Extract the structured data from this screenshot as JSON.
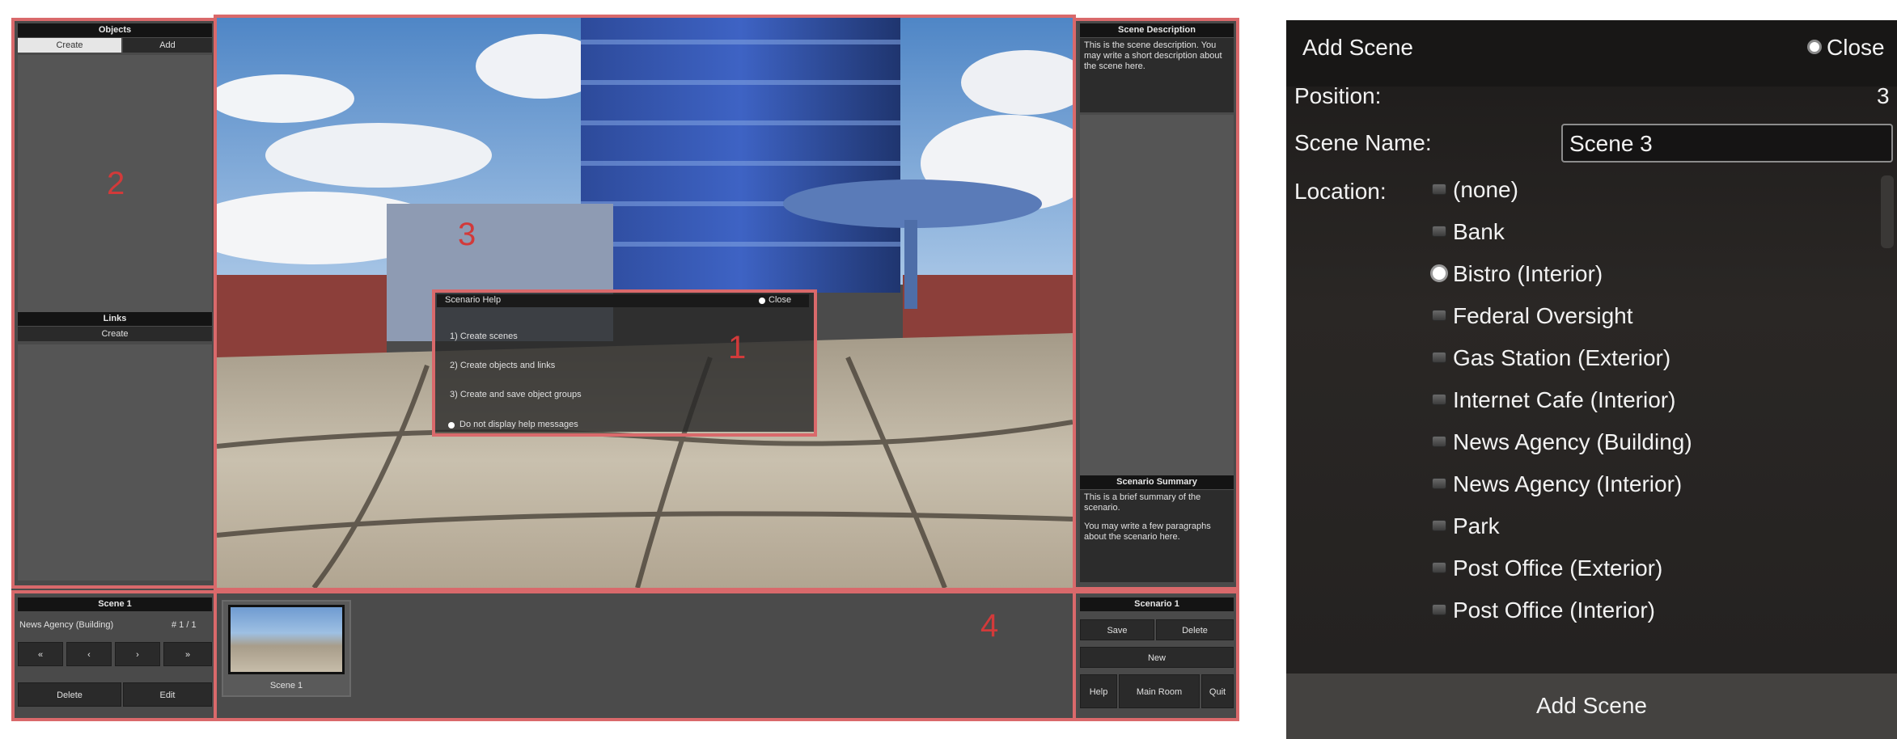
{
  "editor": {
    "objects_header": "Objects",
    "tab_create": "Create",
    "tab_add": "Add",
    "links_header": "Links",
    "links_create": "Create",
    "markers": [
      "1",
      "2",
      "3",
      "4"
    ],
    "help": {
      "title": "Scenario Help",
      "close": "Close",
      "items": [
        "1) Create scenes",
        "2) Create objects and links",
        "3) Create and save object groups"
      ],
      "checkbox_label": "Do not display help messages"
    },
    "scene_description": {
      "header": "Scene Description",
      "text": "This is the scene description. You may write a short description about the scene here."
    },
    "scenario_summary": {
      "header": "Scenario Summary",
      "text1": "This is a brief summary of the scenario.",
      "text2": "You may write a few paragraphs about the scenario here."
    },
    "scene_panel": {
      "header": "Scene 1",
      "location": "News Agency (Building)",
      "index": "# 1 / 1",
      "arrows": [
        "«",
        "‹",
        "›",
        "»"
      ],
      "delete": "Delete",
      "edit": "Edit",
      "thumb_label": "Scene 1"
    },
    "scenario_panel": {
      "header": "Scenario 1",
      "save": "Save",
      "delete": "Delete",
      "new": "New",
      "help": "Help",
      "main_room": "Main Room",
      "quit": "Quit"
    }
  },
  "dialog": {
    "title": "Add Scene",
    "close": "Close",
    "position_label": "Position:",
    "position_value": "3",
    "scene_name_label": "Scene Name:",
    "scene_name_value": "Scene 3",
    "location_label": "Location:",
    "locations": [
      "(none)",
      "Bank",
      "Bistro (Interior)",
      "Federal Oversight",
      "Gas Station (Exterior)",
      "Internet Cafe (Interior)",
      "News Agency (Building)",
      "News Agency (Interior)",
      "Park",
      "Post Office (Exterior)",
      "Post Office (Interior)"
    ],
    "selected_location": "Bistro (Interior)",
    "add_button": "Add Scene"
  }
}
